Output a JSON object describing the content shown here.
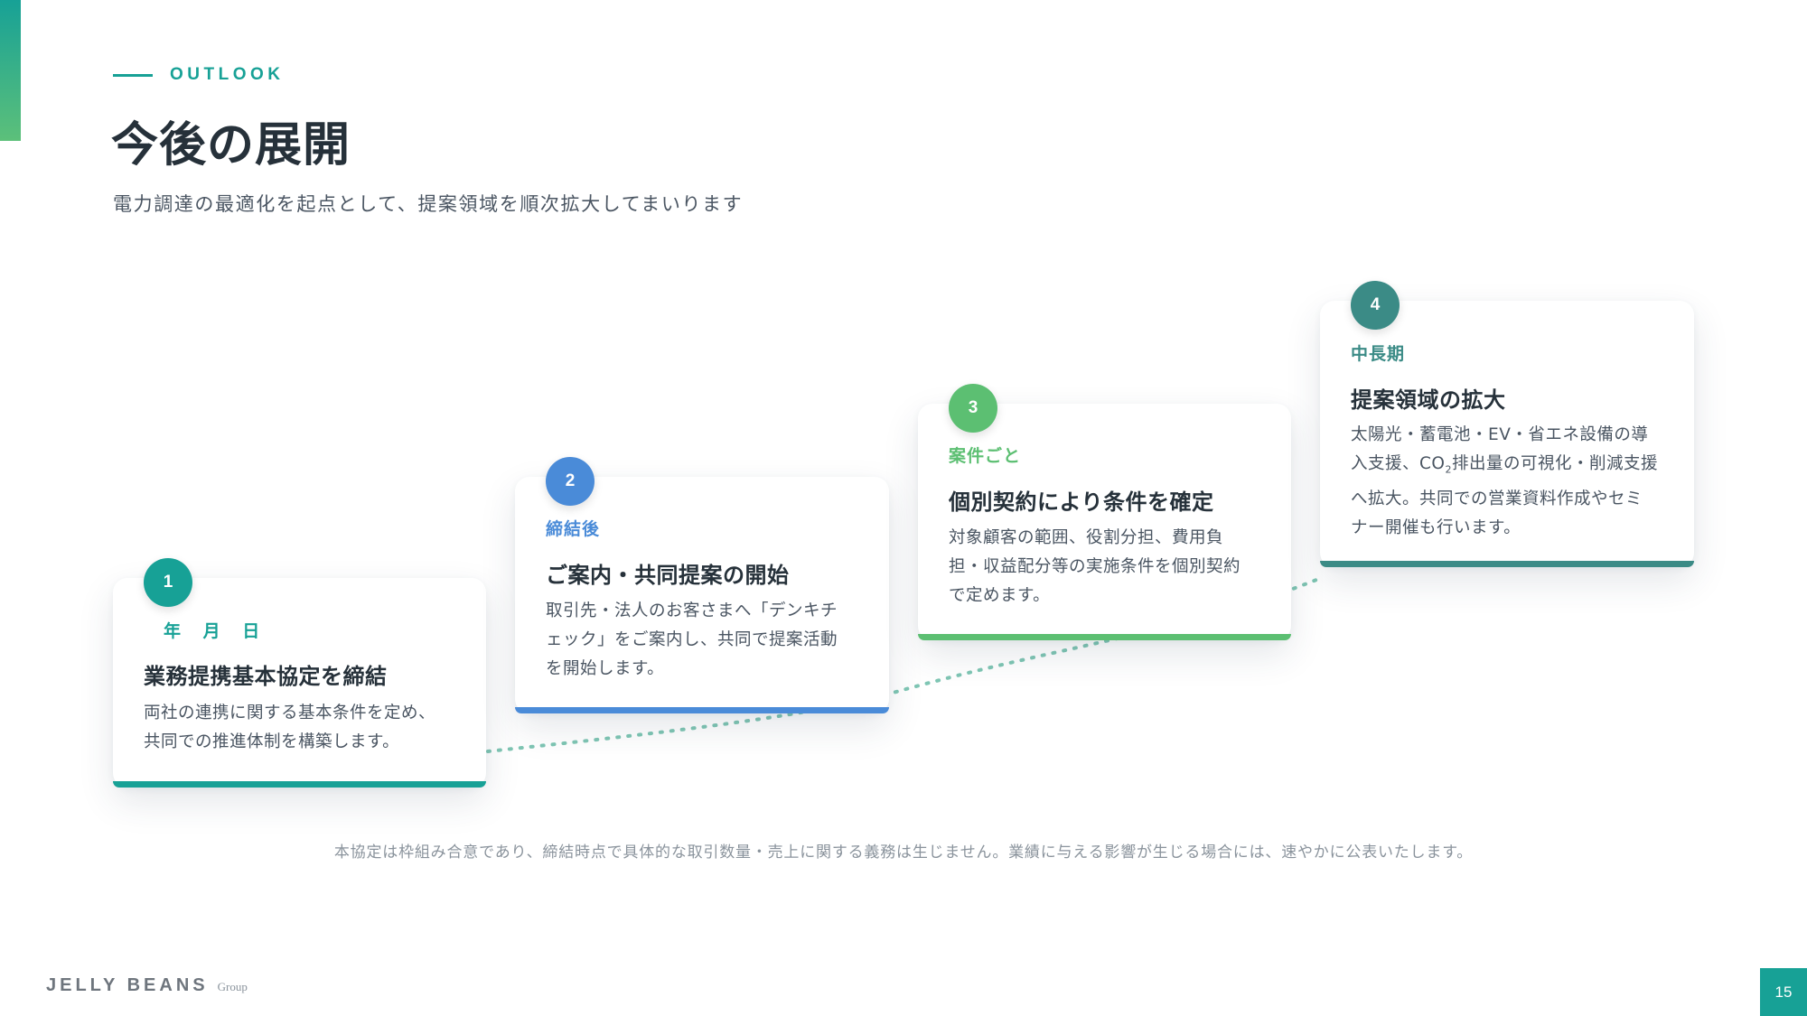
{
  "header": {
    "eyebrow": "OUTLOOK",
    "title": "今後の展開",
    "subtitle": "電力調達の最適化を起点として、提案領域を順次拡大してまいります"
  },
  "steps": [
    {
      "number": "1",
      "period": "年 月 日",
      "title": "業務提携基本協定を締結",
      "desc_lines": [
        "両社の連携に関する基本条件を定め、",
        "共同での推進体制を構築します。"
      ],
      "color": "#17a196"
    },
    {
      "number": "2",
      "period": "締結後",
      "title": "ご案内・共同提案の開始",
      "desc_lines": [
        "取引先・法人のお客さまへ「デンキチ",
        "ェック」をご案内し、共同で提案活動",
        "を開始します。"
      ],
      "color": "#4a8bd8"
    },
    {
      "number": "3",
      "period": "案件ごと",
      "title": "個別契約により条件を確定",
      "desc_lines": [
        "対象顧客の範囲、役割分担、費用負",
        "担・収益配分等の実施条件を個別契約",
        "で定めます。"
      ],
      "color": "#5cbf72"
    },
    {
      "number": "4",
      "period": "中長期",
      "title": "提案領域の拡大",
      "desc_lines": [
        "太陽光・蓄電池・EV・省エネ設備の導",
        "入支援、CO",
        "2",
        "排出量の可視化・削減支援",
        "へ拡大。共同での営業資料作成やセミ",
        "ナー開催も行います。"
      ],
      "color": "#3b8b86"
    }
  ],
  "footnote": "本協定は枠組み合意であり、締結時点で具体的な取引数量・売上に関する義務は生じません。業績に与える影響が生じる場合には、速やかに公表いたします。",
  "footer": {
    "brand": "JELLY BEANS",
    "brand_sub": "Group",
    "page_number": "15"
  },
  "colors": {
    "accent": "#17a196",
    "accent_green": "#5cc07a",
    "connector": "#7fc6b4"
  }
}
